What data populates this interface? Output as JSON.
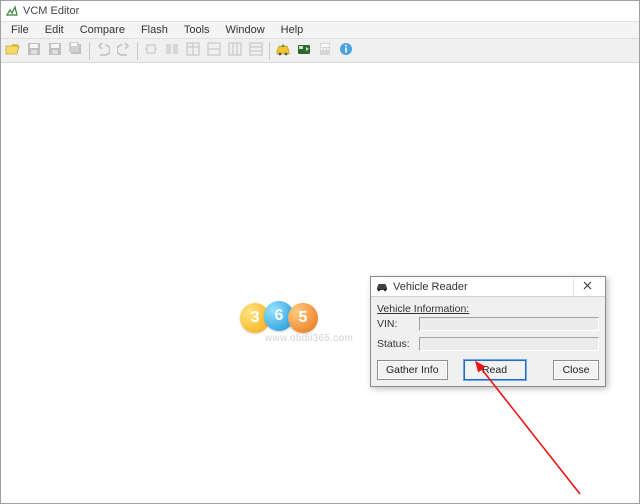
{
  "window": {
    "title": "VCM Editor"
  },
  "menu": {
    "items": [
      "File",
      "Edit",
      "Compare",
      "Flash",
      "Tools",
      "Window",
      "Help"
    ]
  },
  "toolbar": {
    "icons": [
      {
        "name": "open-file-icon",
        "enabled": true
      },
      {
        "name": "save-icon",
        "enabled": false
      },
      {
        "name": "save-as-icon",
        "enabled": false
      },
      {
        "name": "save-all-icon",
        "enabled": false
      },
      {
        "name": "undo-icon",
        "enabled": false
      },
      {
        "name": "redo-icon",
        "enabled": false
      },
      {
        "name": "connect-icon",
        "enabled": false
      },
      {
        "name": "compare-icon",
        "enabled": false
      },
      {
        "name": "table-1-icon",
        "enabled": false
      },
      {
        "name": "table-2-icon",
        "enabled": false
      },
      {
        "name": "table-3-icon",
        "enabled": false
      },
      {
        "name": "table-4-icon",
        "enabled": false
      },
      {
        "name": "read-vehicle-icon",
        "enabled": true
      },
      {
        "name": "write-vehicle-icon",
        "enabled": true
      },
      {
        "name": "calculator-icon",
        "enabled": false
      },
      {
        "name": "about-icon",
        "enabled": true
      }
    ]
  },
  "watermark": {
    "d1": "3",
    "d2": "6",
    "d3": "5",
    "url": "www.obdii365.com"
  },
  "dialog": {
    "title": "Vehicle Reader",
    "section_label": "Vehicle Information:",
    "vin_label": "VIN:",
    "vin_value": "",
    "status_label": "Status:",
    "status_value": "",
    "buttons": {
      "gather": "Gather Info",
      "read": "Read",
      "close": "Close"
    }
  }
}
